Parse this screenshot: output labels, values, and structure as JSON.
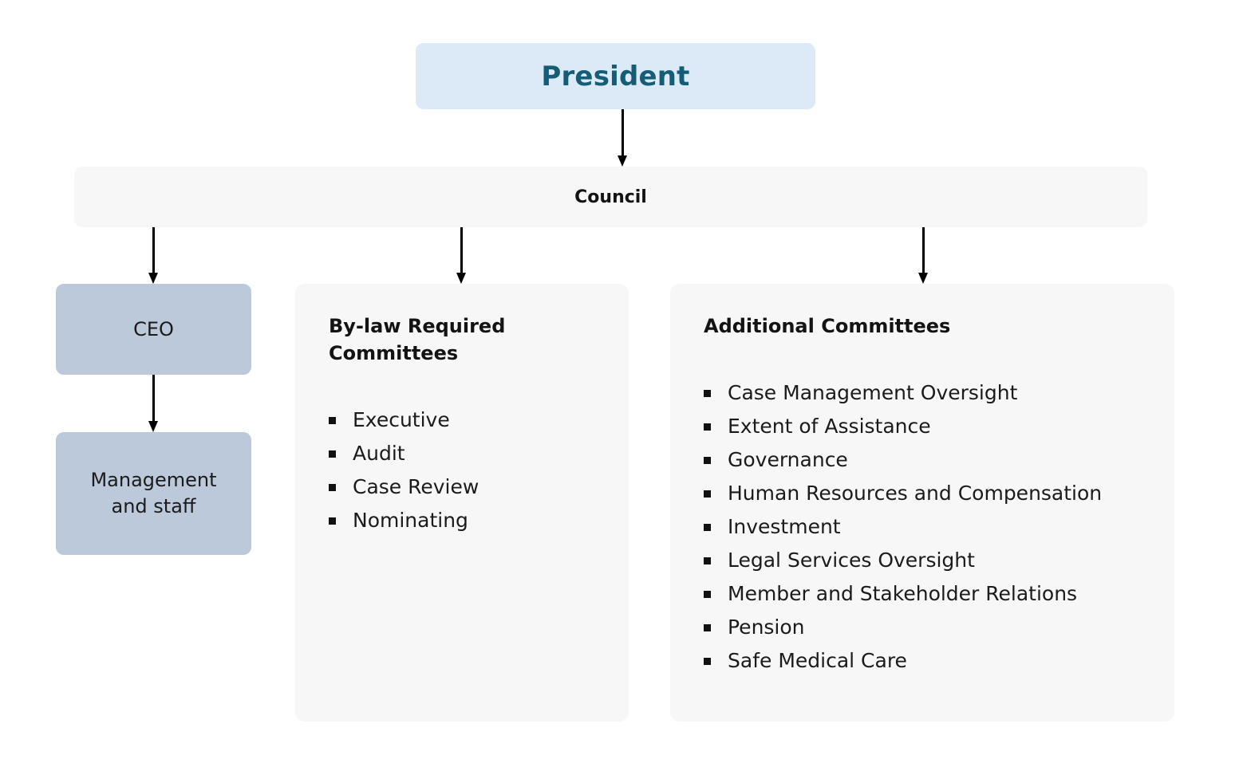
{
  "diagram": {
    "title_node": {
      "label": "President"
    },
    "council_node": {
      "label": "Council"
    },
    "staff_nodes": [
      {
        "label": "CEO"
      },
      {
        "label": "Management\nand staff"
      }
    ],
    "panels": [
      {
        "title": "By-law Required Committees",
        "items": [
          "Executive",
          "Audit",
          "Case Review",
          "Nominating"
        ]
      },
      {
        "title": "Additional Committees",
        "items": [
          "Case Management Oversight",
          "Extent of Assistance",
          "Governance",
          "Human Resources and Compensation",
          "Investment",
          "Legal Services Oversight",
          "Member and Stakeholder Relations",
          "Pension",
          "Safe Medical Care"
        ]
      }
    ],
    "colors": {
      "president_fill": "#dce9f7",
      "president_text": "#145d74",
      "panel_fill": "#f7f7f7",
      "node_fill": "#bcc9db",
      "connector": "#000000",
      "body_text": "#1b1b1b",
      "background": "#ffffff"
    },
    "connectors": [
      {
        "from": "President",
        "to": "Council"
      },
      {
        "from": "Council",
        "to": "CEO"
      },
      {
        "from": "Council",
        "to": "By-law Required Committees"
      },
      {
        "from": "Council",
        "to": "Additional Committees"
      },
      {
        "from": "CEO",
        "to": "Management and staff"
      }
    ]
  }
}
